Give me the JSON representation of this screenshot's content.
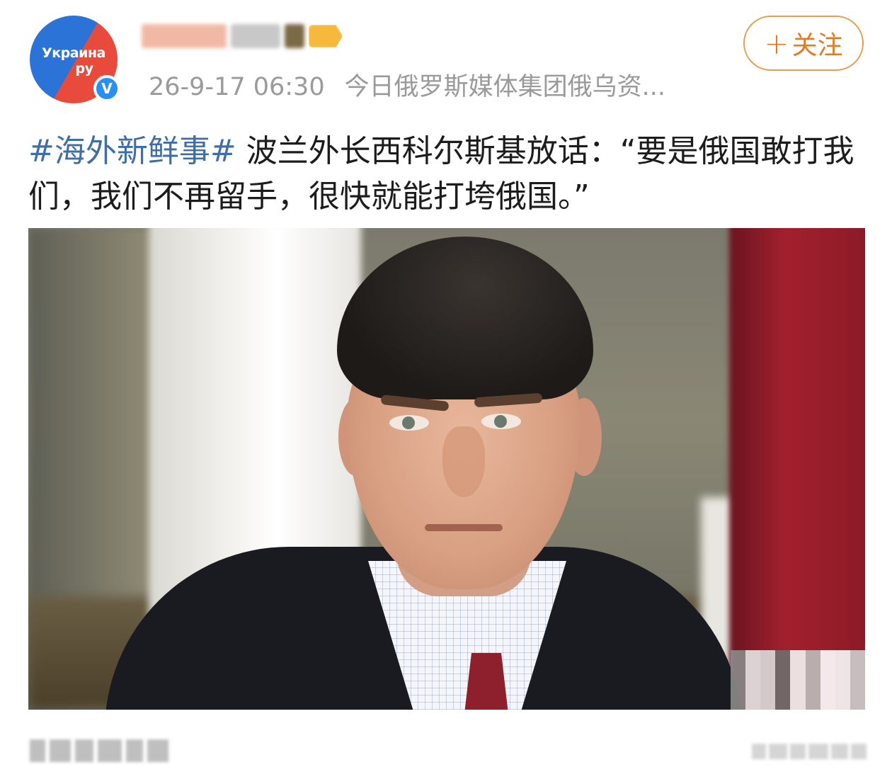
{
  "post": {
    "author": {
      "avatar_logo_line1": "Украина",
      "avatar_logo_line2": "ру",
      "verified_mark": "V"
    },
    "timestamp": "26-9-17 06:30",
    "source": "今日俄罗斯媒体集团俄乌资...",
    "follow_button": {
      "plus": "+",
      "label": "关注"
    },
    "hashtag": "#海外新鲜事#",
    "text": " 波兰外长西科尔斯基放话：“要是俄国敢打我们，我们不再留手，很快就能打垮俄国。”",
    "colors": {
      "hashtag": "#3f6ea6",
      "follow_accent": "#e07b24",
      "verified": "#2b8ff2",
      "avatar_blue": "#2b73d6",
      "avatar_red": "#e84a3c"
    },
    "icons": [
      "verified-badge-icon",
      "vip-badge-icon",
      "plus-icon"
    ]
  }
}
